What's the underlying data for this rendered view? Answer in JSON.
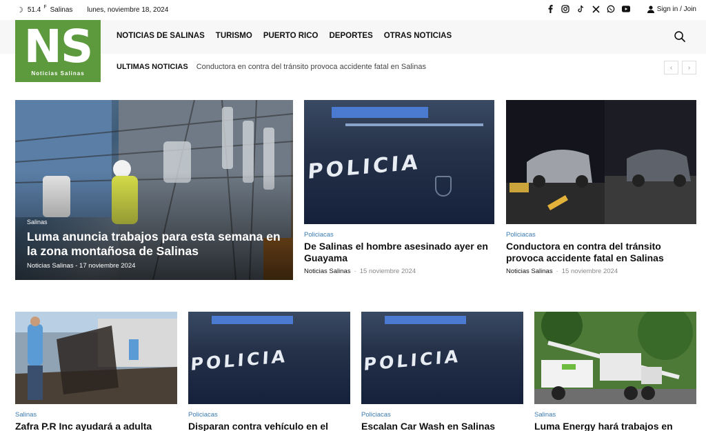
{
  "topbar": {
    "temp": "51.4",
    "unit": "F",
    "city": "Salinas",
    "date": "lunes, noviembre 18, 2024",
    "signin": "Sign in / Join",
    "socials": [
      "facebook-icon",
      "instagram-icon",
      "tiktok-icon",
      "x-icon",
      "whatsapp-icon",
      "youtube-icon"
    ]
  },
  "logo": {
    "mark": "NS",
    "name": "Noticias Salinas"
  },
  "nav": [
    "NOTICIAS DE SALINAS",
    "TURISMO",
    "PUERTO RICO",
    "DEPORTES",
    "OTRAS NOTICIAS"
  ],
  "ticker": {
    "label": "ULTIMAS NOTICIAS",
    "headline": "Conductora en contra del tránsito provoca accidente fatal en Salinas"
  },
  "feature": {
    "category": "Salinas",
    "title": "Luma anuncia trabajos para esta semana en la zona montañosa de Salinas",
    "author": "Noticias Salinas",
    "date": "17 noviembre 2024"
  },
  "top_cards": [
    {
      "category": "Policiacas",
      "title": "De Salinas el hombre asesinado ayer en Guayama",
      "author": "Noticias Salinas",
      "date": "15 noviembre 2024"
    },
    {
      "category": "Policiacas",
      "title": "Conductora en contra del tránsito provoca accidente fatal en Salinas",
      "author": "Noticias Salinas",
      "date": "15 noviembre 2024"
    }
  ],
  "bottom_cards": [
    {
      "category": "Salinas",
      "title": "Zafra P.R Inc ayudará a adulta mayor que"
    },
    {
      "category": "Policiacas",
      "title": "Disparan contra vehículo en el barrio San"
    },
    {
      "category": "Policiacas",
      "title": "Escalan Car Wash en Salinas"
    },
    {
      "category": "Salinas",
      "title": "Luma Energy hará trabajos en Godreau y"
    }
  ],
  "police_word": "POLICIA",
  "colors": {
    "brand": "#5d9a3d",
    "category": "#3a7ab0"
  }
}
